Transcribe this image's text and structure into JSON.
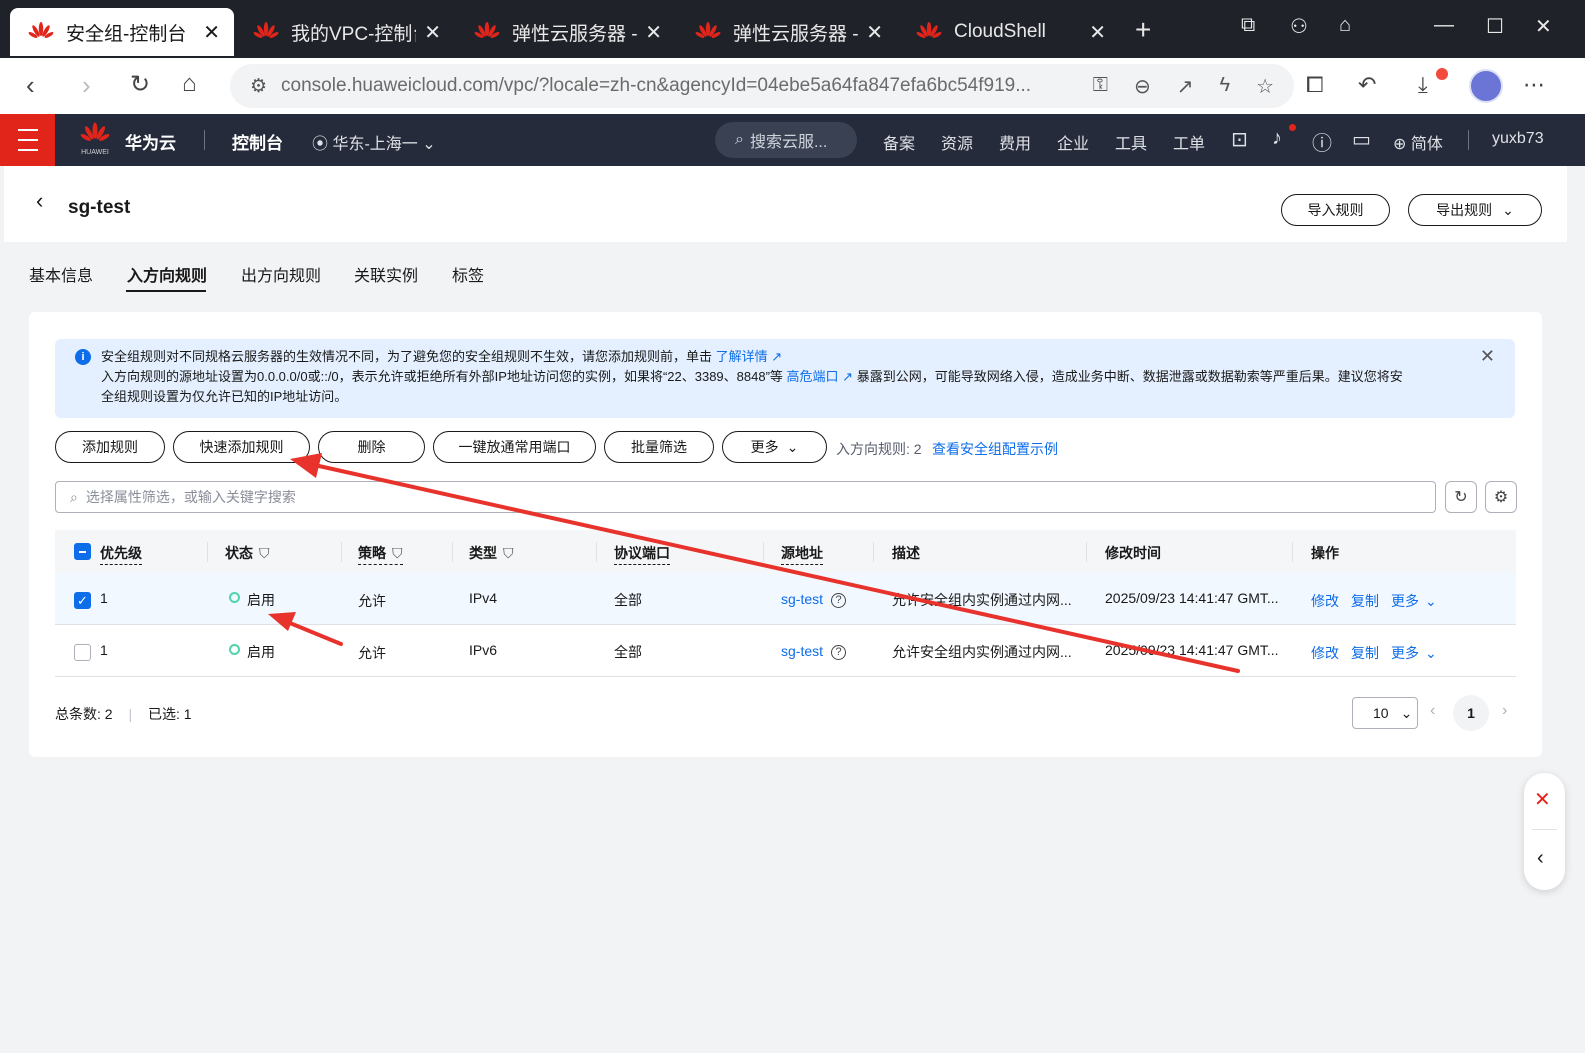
{
  "browser": {
    "tabs": [
      {
        "label": "安全组-控制台",
        "active": true
      },
      {
        "label": "我的VPC-控制台",
        "active": false
      },
      {
        "label": "弹性云服务器 - 控",
        "active": false
      },
      {
        "label": "弹性云服务器 - 控",
        "active": false
      },
      {
        "label": "CloudShell",
        "active": false
      }
    ],
    "url": "console.huaweicloud.com/vpc/?locale=zh-cn&agencyId=04ebe5a64fa847efa6bc54f919..."
  },
  "header": {
    "brand": "华为云",
    "logo_sub": "HUAWEI",
    "console": "控制台",
    "region": "华东-上海一",
    "search_placeholder": "搜索云服...",
    "nav": [
      "备案",
      "资源",
      "费用",
      "企业",
      "工具",
      "工单"
    ],
    "lang": "简体",
    "user": "yuxb73"
  },
  "page": {
    "title": "sg-test",
    "import_btn": "导入规则",
    "export_btn": "导出规则",
    "tabs": [
      "基本信息",
      "入方向规则",
      "出方向规则",
      "关联实例",
      "标签"
    ],
    "active_tab": "入方向规则"
  },
  "notice": {
    "line1": "安全组规则对不同规格云服务器的生效情况不同，为了避免您的安全组规则不生效，请您添加规则前，单击",
    "link1": "了解详情",
    "line2": "入方向规则的源地址设置为0.0.0.0/0或::/0，表示允许或拒绝所有外部IP地址访问您的实例，如果将“22、3389、8848”等",
    "link2": "高危端口",
    "line2b": "暴露到公网，可能导致网络入侵，造成业务中断、数据泄露或数据勒索等严重后果。建议您将安",
    "line3": "全组规则设置为仅允许已知的IP地址访问。"
  },
  "toolbar": {
    "add": "添加规则",
    "quick_add": "快速添加规则",
    "delete": "删除",
    "open_ports": "一键放通常用端口",
    "batch_filter": "批量筛选",
    "more": "更多",
    "count_label": "入方向规则: 2",
    "example_link": "查看安全组配置示例"
  },
  "search": {
    "placeholder": "选择属性筛选，或输入关键字搜索"
  },
  "table": {
    "headers": [
      "优先级",
      "状态",
      "策略",
      "类型",
      "协议端口",
      "源地址",
      "描述",
      "修改时间",
      "操作"
    ],
    "rows": [
      {
        "checked": true,
        "priority": "1",
        "status": "启用",
        "policy": "允许",
        "type": "IPv4",
        "port": "全部",
        "source": "sg-test",
        "desc": "允许安全组内实例通过内网...",
        "time": "2025/09/23 14:41:47 GMT...",
        "actions": [
          "修改",
          "复制",
          "更多"
        ]
      },
      {
        "checked": false,
        "priority": "1",
        "status": "启用",
        "policy": "允许",
        "type": "IPv6",
        "port": "全部",
        "source": "sg-test",
        "desc": "允许安全组内实例通过内网...",
        "time": "2025/09/23 14:41:47 GMT...",
        "actions": [
          "修改",
          "复制",
          "更多"
        ]
      }
    ]
  },
  "footer": {
    "total": "总条数: 2",
    "selected": "已选: 1",
    "page_size": "10",
    "current_page": "1"
  },
  "colors": {
    "brand_red": "#e1251b",
    "link_blue": "#0e6de8",
    "annotation_red": "#e8322c",
    "status_green": "#50d4ab"
  }
}
